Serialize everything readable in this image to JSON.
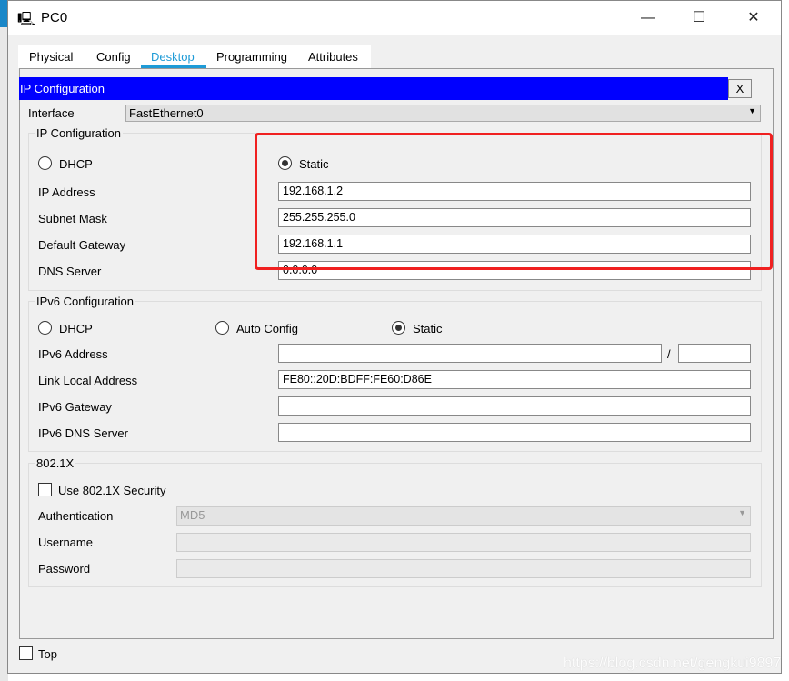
{
  "window": {
    "title": "PC0",
    "minimize": "—",
    "maximize": "☐",
    "close": "✕"
  },
  "tabs": [
    "Physical",
    "Config",
    "Desktop",
    "Programming",
    "Attributes"
  ],
  "active_tab": "Desktop",
  "header": {
    "title": "IP Configuration",
    "close": "X"
  },
  "interface": {
    "label": "Interface",
    "value": "FastEthernet0"
  },
  "ipv4": {
    "title": "IP Configuration",
    "dhcp": "DHCP",
    "static": "Static",
    "mode": "Static",
    "fields": [
      {
        "label": "IP Address",
        "value": "192.168.1.2"
      },
      {
        "label": "Subnet Mask",
        "value": "255.255.255.0"
      },
      {
        "label": "Default Gateway",
        "value": "192.168.1.1"
      },
      {
        "label": "DNS Server",
        "value": "0.0.0.0"
      }
    ]
  },
  "ipv6": {
    "title": "IPv6 Configuration",
    "dhcp": "DHCP",
    "auto": "Auto Config",
    "static": "Static",
    "mode": "Static",
    "slash": "/",
    "fields": [
      {
        "label": "IPv6 Address",
        "value": ""
      },
      {
        "label": "Link Local Address",
        "value": "FE80::20D:BDFF:FE60:D86E"
      },
      {
        "label": "IPv6 Gateway",
        "value": ""
      },
      {
        "label": "IPv6 DNS Server",
        "value": ""
      }
    ]
  },
  "dot1x": {
    "title": "802.1X",
    "use_label": "Use 802.1X Security",
    "checked": false,
    "auth_label": "Authentication",
    "auth_value": "MD5",
    "username_label": "Username",
    "password_label": "Password"
  },
  "footer": {
    "top_label": "Top",
    "top_checked": false
  },
  "watermark": "https://blog.csdn.net/gengkui9897",
  "colors": {
    "accent": "#1e9bd7",
    "header": "#0000ff",
    "highlight": "#f02020"
  }
}
